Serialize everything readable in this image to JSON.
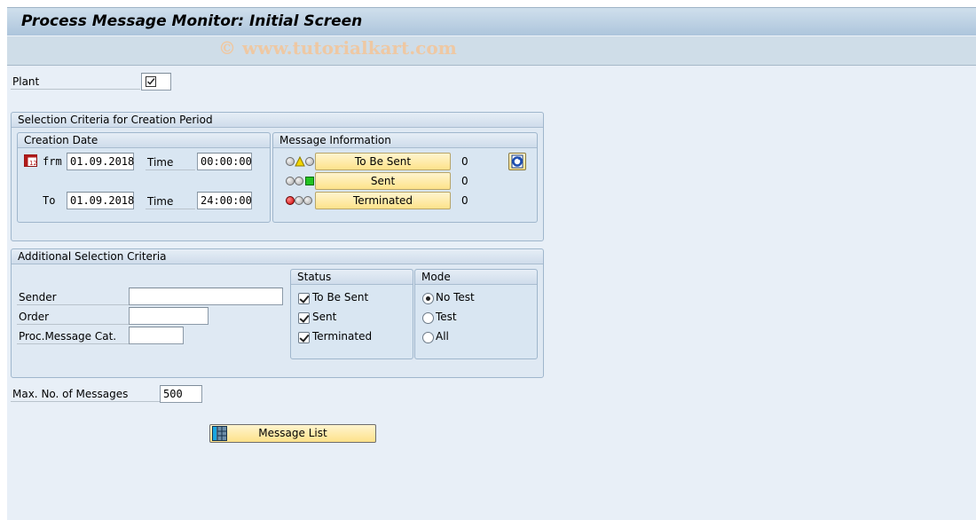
{
  "header": {
    "title": "Process Message Monitor: Initial Screen",
    "watermark": "© www.tutorialkart.com"
  },
  "plant": {
    "label": "Plant",
    "checked": true
  },
  "creation_period": {
    "title": "Selection Criteria for Creation Period",
    "creation_date": {
      "title": "Creation Date",
      "from_label": "frm",
      "from_date": "01.09.2018",
      "from_time_label": "Time",
      "from_time": "00:00:00",
      "to_label": "To",
      "to_date": "01.09.2018",
      "to_time_label": "Time",
      "to_time": "24:00:00"
    },
    "message_info": {
      "title": "Message Information",
      "rows": [
        {
          "status_icon": "traffic-light-yellow-icon",
          "label": "To Be Sent",
          "count": "0"
        },
        {
          "status_icon": "traffic-light-green-icon",
          "label": "Sent",
          "count": "0"
        },
        {
          "status_icon": "traffic-light-red-icon",
          "label": "Terminated",
          "count": "0"
        }
      ],
      "refresh_icon": "refresh-icon"
    }
  },
  "additional": {
    "title": "Additional Selection Criteria",
    "fields": [
      {
        "label": "Sender",
        "value": ""
      },
      {
        "label": "Order",
        "value": ""
      },
      {
        "label": "Proc.Message Cat.",
        "value": ""
      }
    ],
    "status": {
      "title": "Status",
      "options": [
        {
          "label": "To Be Sent",
          "checked": true
        },
        {
          "label": "Sent",
          "checked": true
        },
        {
          "label": "Terminated",
          "checked": true
        }
      ]
    },
    "mode": {
      "title": "Mode",
      "options": [
        {
          "label": "No Test",
          "selected": true
        },
        {
          "label": "Test",
          "selected": false
        },
        {
          "label": "All",
          "selected": false
        }
      ]
    }
  },
  "max_messages": {
    "label": "Max. No. of Messages",
    "value": "500"
  },
  "message_list_button": {
    "label": "Message List",
    "icon": "list-icon"
  },
  "colors": {
    "button_yellow": "#fde28a",
    "light_yellow": "#f2d500",
    "light_green": "#22c322",
    "light_red": "#e00000"
  }
}
